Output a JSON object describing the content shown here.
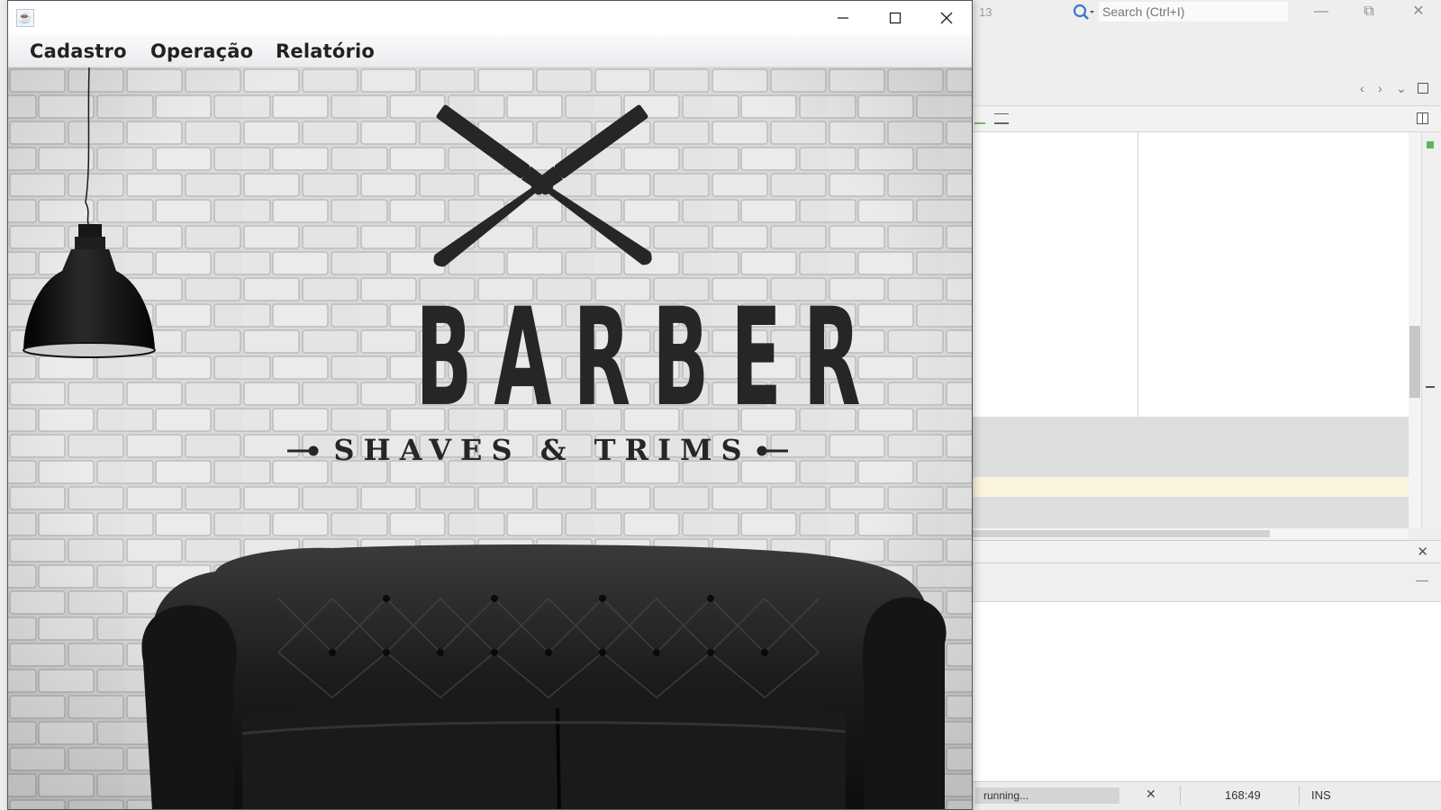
{
  "ide": {
    "title_fragment": "13",
    "search_placeholder": "Search (Ctrl+I)",
    "status": {
      "progress_text": "running...",
      "caret_position": "168:49",
      "insert_mode": "INS"
    }
  },
  "app_window": {
    "menu": [
      {
        "label": "Cadastro"
      },
      {
        "label": "Operação"
      },
      {
        "label": "Relatório"
      }
    ],
    "banner": {
      "title": "BARBER",
      "subtitle": "SHAVES & TRIMS"
    }
  },
  "colors": {
    "ink": "#262626",
    "brick_wall": "#d8d8d8",
    "menubar": "#eceef1"
  },
  "icons": [
    "java-app-icon",
    "minimize-icon",
    "maximize-icon",
    "close-icon",
    "search-icon",
    "razor-icon",
    "pendant-lamp",
    "chesterfield-sofa"
  ]
}
